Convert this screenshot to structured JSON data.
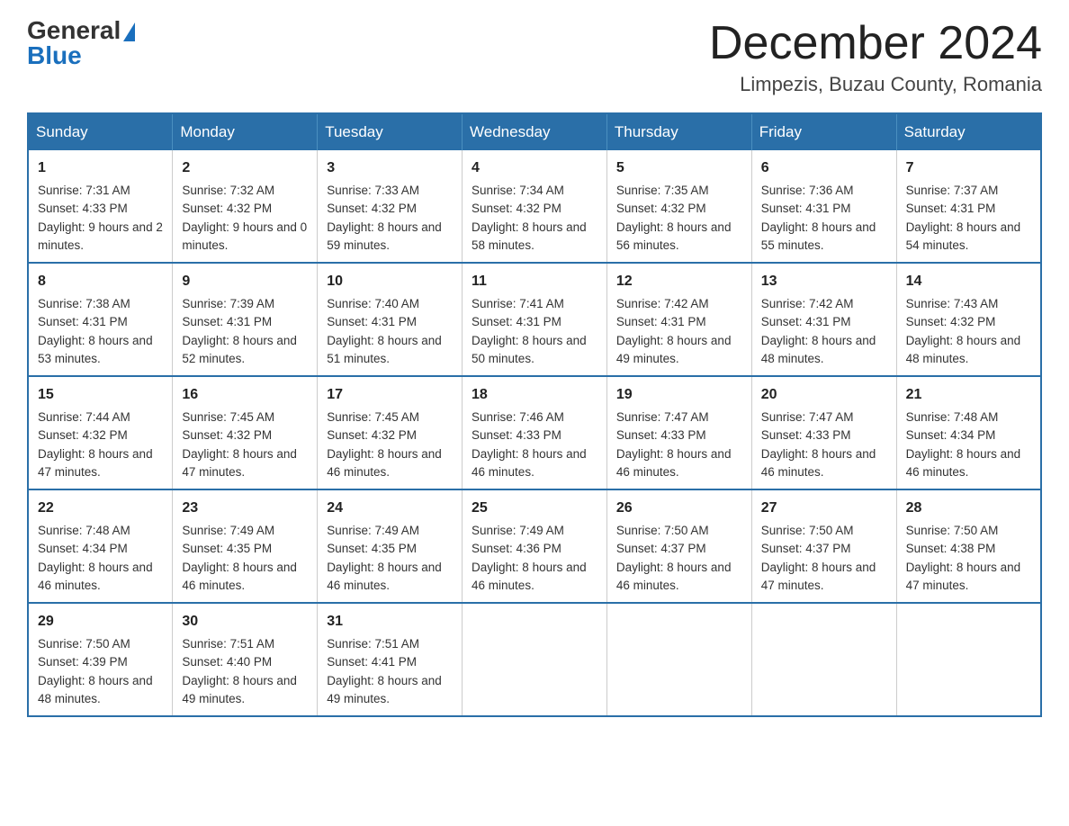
{
  "header": {
    "logo_general": "General",
    "logo_blue": "Blue",
    "month_title": "December 2024",
    "location": "Limpezis, Buzau County, Romania"
  },
  "days_of_week": [
    "Sunday",
    "Monday",
    "Tuesday",
    "Wednesday",
    "Thursday",
    "Friday",
    "Saturday"
  ],
  "weeks": [
    [
      {
        "day": "1",
        "sunrise": "7:31 AM",
        "sunset": "4:33 PM",
        "daylight": "9 hours and 2 minutes."
      },
      {
        "day": "2",
        "sunrise": "7:32 AM",
        "sunset": "4:32 PM",
        "daylight": "9 hours and 0 minutes."
      },
      {
        "day": "3",
        "sunrise": "7:33 AM",
        "sunset": "4:32 PM",
        "daylight": "8 hours and 59 minutes."
      },
      {
        "day": "4",
        "sunrise": "7:34 AM",
        "sunset": "4:32 PM",
        "daylight": "8 hours and 58 minutes."
      },
      {
        "day": "5",
        "sunrise": "7:35 AM",
        "sunset": "4:32 PM",
        "daylight": "8 hours and 56 minutes."
      },
      {
        "day": "6",
        "sunrise": "7:36 AM",
        "sunset": "4:31 PM",
        "daylight": "8 hours and 55 minutes."
      },
      {
        "day": "7",
        "sunrise": "7:37 AM",
        "sunset": "4:31 PM",
        "daylight": "8 hours and 54 minutes."
      }
    ],
    [
      {
        "day": "8",
        "sunrise": "7:38 AM",
        "sunset": "4:31 PM",
        "daylight": "8 hours and 53 minutes."
      },
      {
        "day": "9",
        "sunrise": "7:39 AM",
        "sunset": "4:31 PM",
        "daylight": "8 hours and 52 minutes."
      },
      {
        "day": "10",
        "sunrise": "7:40 AM",
        "sunset": "4:31 PM",
        "daylight": "8 hours and 51 minutes."
      },
      {
        "day": "11",
        "sunrise": "7:41 AM",
        "sunset": "4:31 PM",
        "daylight": "8 hours and 50 minutes."
      },
      {
        "day": "12",
        "sunrise": "7:42 AM",
        "sunset": "4:31 PM",
        "daylight": "8 hours and 49 minutes."
      },
      {
        "day": "13",
        "sunrise": "7:42 AM",
        "sunset": "4:31 PM",
        "daylight": "8 hours and 48 minutes."
      },
      {
        "day": "14",
        "sunrise": "7:43 AM",
        "sunset": "4:32 PM",
        "daylight": "8 hours and 48 minutes."
      }
    ],
    [
      {
        "day": "15",
        "sunrise": "7:44 AM",
        "sunset": "4:32 PM",
        "daylight": "8 hours and 47 minutes."
      },
      {
        "day": "16",
        "sunrise": "7:45 AM",
        "sunset": "4:32 PM",
        "daylight": "8 hours and 47 minutes."
      },
      {
        "day": "17",
        "sunrise": "7:45 AM",
        "sunset": "4:32 PM",
        "daylight": "8 hours and 46 minutes."
      },
      {
        "day": "18",
        "sunrise": "7:46 AM",
        "sunset": "4:33 PM",
        "daylight": "8 hours and 46 minutes."
      },
      {
        "day": "19",
        "sunrise": "7:47 AM",
        "sunset": "4:33 PM",
        "daylight": "8 hours and 46 minutes."
      },
      {
        "day": "20",
        "sunrise": "7:47 AM",
        "sunset": "4:33 PM",
        "daylight": "8 hours and 46 minutes."
      },
      {
        "day": "21",
        "sunrise": "7:48 AM",
        "sunset": "4:34 PM",
        "daylight": "8 hours and 46 minutes."
      }
    ],
    [
      {
        "day": "22",
        "sunrise": "7:48 AM",
        "sunset": "4:34 PM",
        "daylight": "8 hours and 46 minutes."
      },
      {
        "day": "23",
        "sunrise": "7:49 AM",
        "sunset": "4:35 PM",
        "daylight": "8 hours and 46 minutes."
      },
      {
        "day": "24",
        "sunrise": "7:49 AM",
        "sunset": "4:35 PM",
        "daylight": "8 hours and 46 minutes."
      },
      {
        "day": "25",
        "sunrise": "7:49 AM",
        "sunset": "4:36 PM",
        "daylight": "8 hours and 46 minutes."
      },
      {
        "day": "26",
        "sunrise": "7:50 AM",
        "sunset": "4:37 PM",
        "daylight": "8 hours and 46 minutes."
      },
      {
        "day": "27",
        "sunrise": "7:50 AM",
        "sunset": "4:37 PM",
        "daylight": "8 hours and 47 minutes."
      },
      {
        "day": "28",
        "sunrise": "7:50 AM",
        "sunset": "4:38 PM",
        "daylight": "8 hours and 47 minutes."
      }
    ],
    [
      {
        "day": "29",
        "sunrise": "7:50 AM",
        "sunset": "4:39 PM",
        "daylight": "8 hours and 48 minutes."
      },
      {
        "day": "30",
        "sunrise": "7:51 AM",
        "sunset": "4:40 PM",
        "daylight": "8 hours and 49 minutes."
      },
      {
        "day": "31",
        "sunrise": "7:51 AM",
        "sunset": "4:41 PM",
        "daylight": "8 hours and 49 minutes."
      },
      null,
      null,
      null,
      null
    ]
  ],
  "labels": {
    "sunrise": "Sunrise:",
    "sunset": "Sunset:",
    "daylight": "Daylight:"
  }
}
